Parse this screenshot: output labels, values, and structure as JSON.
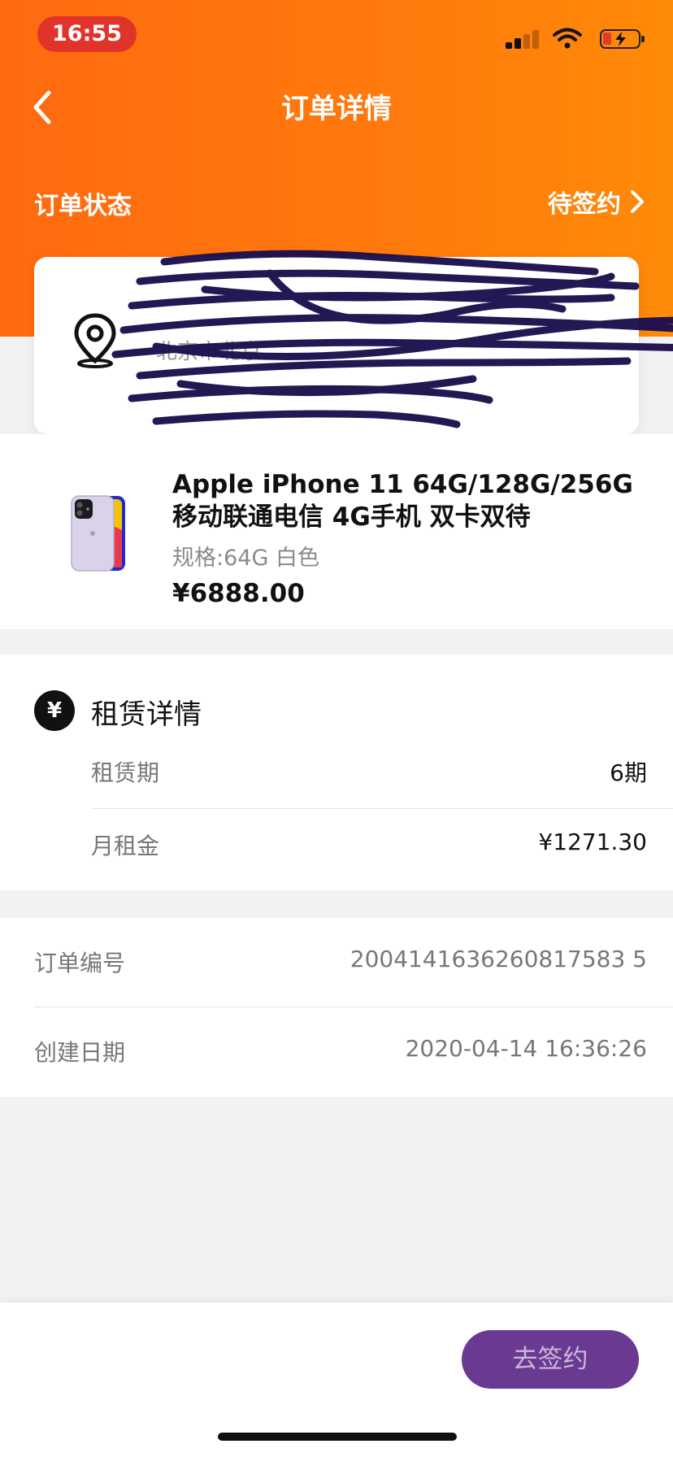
{
  "status_bar": {
    "time": "16:55"
  },
  "nav": {
    "title": "订单详情"
  },
  "order_status": {
    "label": "订单状态",
    "value": "待签约"
  },
  "address": {
    "text": "北京市北京"
  },
  "product": {
    "title": "Apple iPhone 11 64G/128G/256G 移动联通电信 4G手机 双卡双待",
    "spec": "规格:64G 白色",
    "price": "¥6888.00"
  },
  "lease": {
    "title": "租赁详情",
    "icon": "¥",
    "term_label": "租赁期",
    "term_value": "6期",
    "rent_label": "月租金",
    "rent_value": "¥1271.30"
  },
  "info": {
    "order_no_label": "订单编号",
    "order_no": "2004141636260817583 5",
    "created_label": "创建日期",
    "created": "2020-04-14 16:36:26"
  },
  "actions": {
    "sign": "去签约"
  },
  "colors": {
    "header": "#ff7a0c",
    "button": "#6a3a92",
    "scribble": "#1c0f4e"
  }
}
